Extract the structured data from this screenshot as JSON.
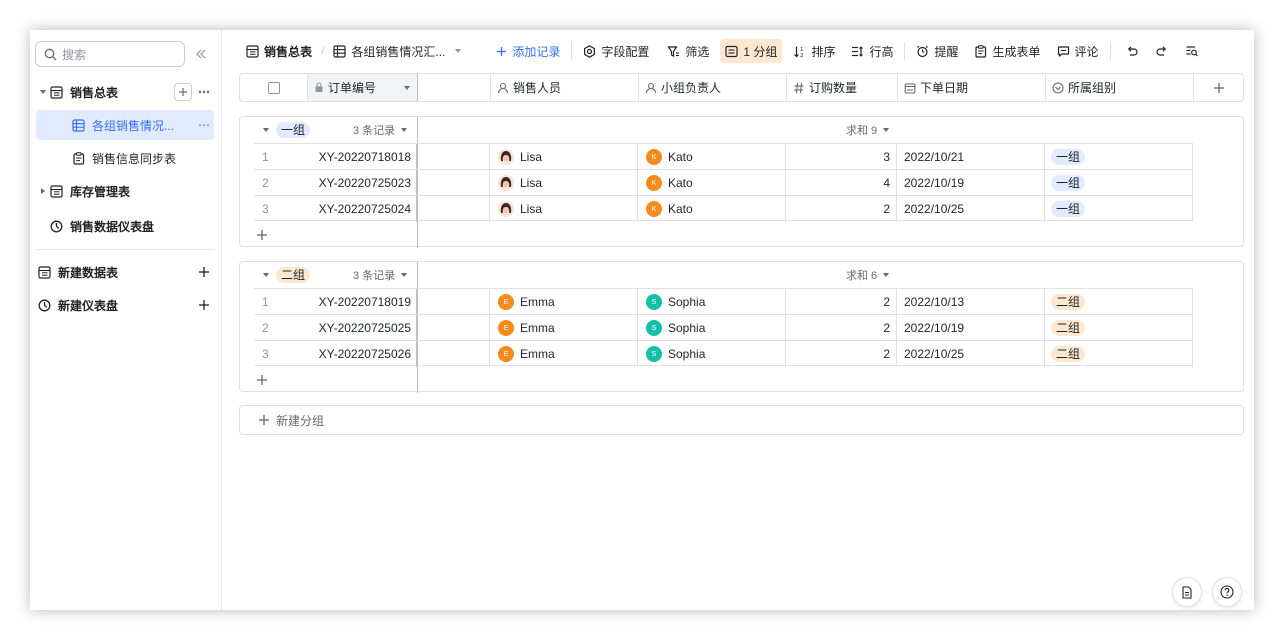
{
  "sidebar": {
    "search_placeholder": "搜索",
    "items": [
      {
        "label": "销售总表"
      },
      {
        "label": "各组销售情况..."
      },
      {
        "label": "销售信息同步表"
      },
      {
        "label": "库存管理表"
      },
      {
        "label": "销售数据仪表盘"
      }
    ],
    "new_table": "新建数据表",
    "new_dashboard": "新建仪表盘"
  },
  "toolbar": {
    "table_name": "销售总表",
    "view_name": "各组销售情况汇...",
    "add_record": "添加记录",
    "field_config": "字段配置",
    "filter": "筛选",
    "group": "1 分组",
    "sort": "排序",
    "row_height": "行高",
    "reminder": "提醒",
    "form": "生成表单",
    "comment": "评论"
  },
  "columns": [
    "订单编号",
    "销售人员",
    "小组负责人",
    "订购数量",
    "下单日期",
    "所属组别"
  ],
  "groups": [
    {
      "name": "一组",
      "count_label": "3 条记录",
      "sum_label": "求和 9",
      "tag_bg": "#e1eaff",
      "rows": [
        {
          "idx": "1",
          "order": "XY-20220718018",
          "seller": "Lisa",
          "leader": "Kato",
          "qty": "3",
          "date": "2022/10/21",
          "group": "一组"
        },
        {
          "idx": "2",
          "order": "XY-20220725023",
          "seller": "Lisa",
          "leader": "Kato",
          "qty": "4",
          "date": "2022/10/19",
          "group": "一组"
        },
        {
          "idx": "3",
          "order": "XY-20220725024",
          "seller": "Lisa",
          "leader": "Kato",
          "qty": "2",
          "date": "2022/10/25",
          "group": "一组"
        }
      ]
    },
    {
      "name": "二组",
      "count_label": "3 条记录",
      "sum_label": "求和 6",
      "tag_bg": "#fde8cf",
      "rows": [
        {
          "idx": "1",
          "order": "XY-20220718019",
          "seller": "Emma",
          "leader": "Sophia",
          "qty": "2",
          "date": "2022/10/13",
          "group": "二组"
        },
        {
          "idx": "2",
          "order": "XY-20220725025",
          "seller": "Emma",
          "leader": "Sophia",
          "qty": "2",
          "date": "2022/10/19",
          "group": "二组"
        },
        {
          "idx": "3",
          "order": "XY-20220725026",
          "seller": "Emma",
          "leader": "Sophia",
          "qty": "2",
          "date": "2022/10/25",
          "group": "二组"
        }
      ]
    }
  ],
  "new_group": "新建分组",
  "colors": {
    "accent": "#3370ff",
    "kato_avatar": "#f58a1f",
    "emma_avatar": "#f58a1f",
    "sophia_avatar": "#14c0a8"
  }
}
